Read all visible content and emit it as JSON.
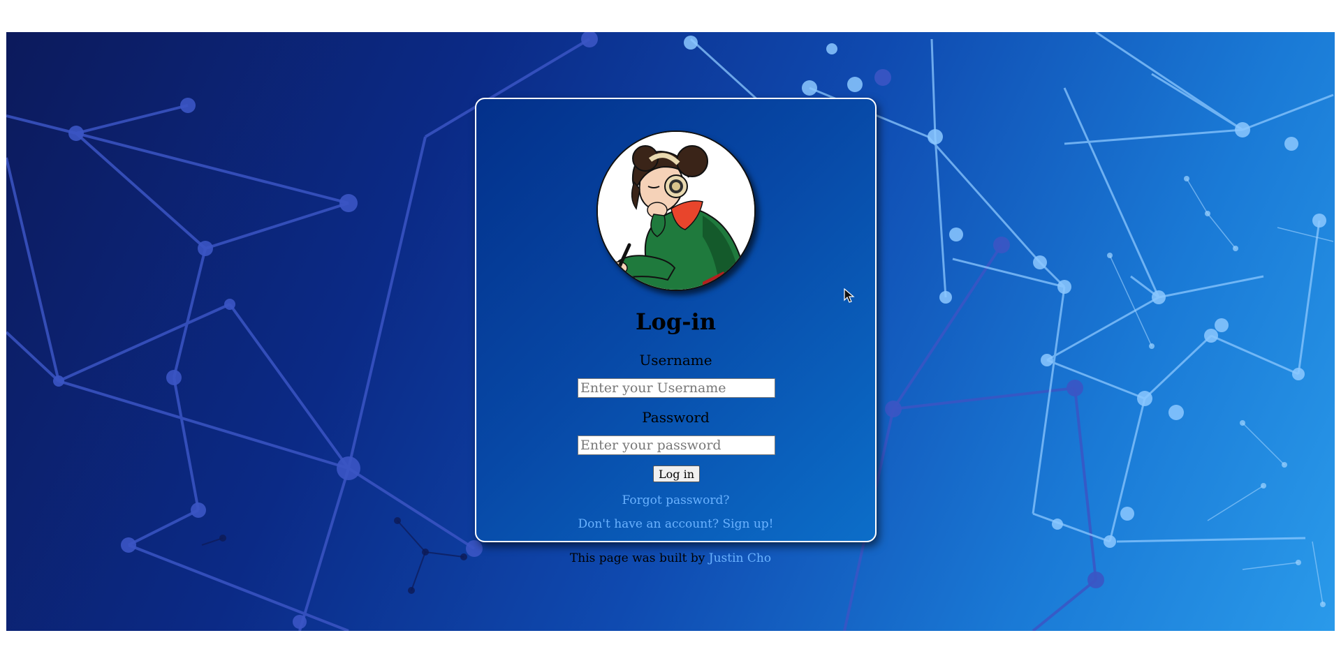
{
  "login": {
    "title": "Log-in",
    "username_label": "Username",
    "username_placeholder": "Enter your Username",
    "password_label": "Password",
    "password_placeholder": "Enter your password",
    "submit_label": "Log in",
    "forgot_link": "Forgot password?",
    "signup_link": "Don't have an account? Sign up!"
  },
  "footer": {
    "text": "This page was built by ",
    "author": "Justin Cho"
  },
  "colors": {
    "link": "#6ab2ff",
    "card_bg": "#0748a6",
    "page_bg_dark": "#0c1a5c",
    "page_bg_light": "#2a9aea"
  },
  "icons": {
    "avatar": "anime-girl-with-headphones-avatar",
    "cursor": "mouse-pointer-icon"
  }
}
